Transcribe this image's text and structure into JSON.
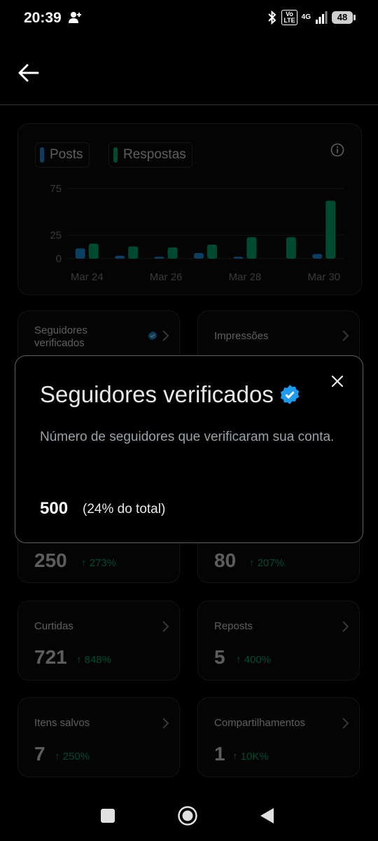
{
  "status_bar": {
    "time": "20:39",
    "volte": "Vo\nLTE",
    "network": "4G",
    "battery": "48"
  },
  "chart": {
    "legend": [
      {
        "label": "Posts",
        "color": "#1d9bf0"
      },
      {
        "label": "Respostas",
        "color": "#00ba7c"
      }
    ]
  },
  "chart_data": {
    "type": "bar",
    "categories": [
      "Mar 24",
      "Mar 25",
      "Mar 26",
      "Mar 27",
      "Mar 28",
      "Mar 29",
      "Mar 30"
    ],
    "x_tick_labels": [
      "Mar 24",
      "Mar 26",
      "Mar 28",
      "Mar 30"
    ],
    "series": [
      {
        "name": "Posts",
        "color": "#1d9bf0",
        "values": [
          11,
          3,
          2,
          6,
          2,
          0,
          5
        ]
      },
      {
        "name": "Respostas",
        "color": "#00ba7c",
        "values": [
          16,
          13,
          12,
          15,
          23,
          23,
          62
        ]
      }
    ],
    "y_ticks": [
      0,
      25,
      75
    ],
    "ylim": [
      0,
      75
    ],
    "grid": true
  },
  "cards": {
    "verified_followers": {
      "title": "Seguidores verificados"
    },
    "impressions": {
      "title": "Impressões"
    },
    "row2_left": {
      "value": "250",
      "change": "↑ 273%"
    },
    "row2_right": {
      "value": "80",
      "change": "↑ 207%"
    },
    "likes": {
      "title": "Curtidas",
      "value": "721",
      "change": "↑ 848%"
    },
    "reposts": {
      "title": "Reposts",
      "value": "5",
      "change": "↑ 400%"
    },
    "saved": {
      "title": "Itens salvos",
      "value": "7",
      "change": "↑ 250%"
    },
    "shares": {
      "title": "Compartilhamentos",
      "value": "1",
      "change": "↑ 10K%"
    }
  },
  "modal": {
    "title": "Seguidores verificados",
    "description": "Número de seguidores que verificaram sua conta.",
    "value": "500",
    "percent": "(24% do total)"
  },
  "colors": {
    "accent": "#1d9bf0",
    "positive": "#00ba7c",
    "background": "#000000",
    "border": "#2f3336"
  }
}
